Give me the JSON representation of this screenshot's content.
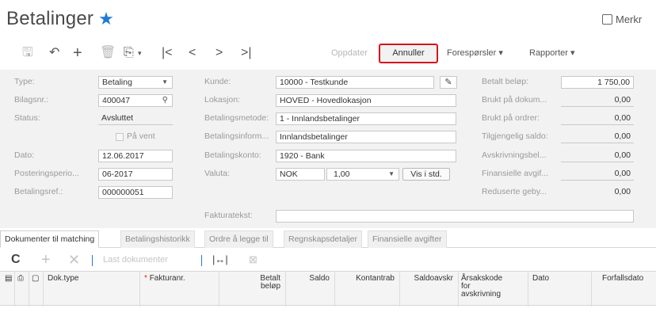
{
  "page": {
    "title": "Betalinger",
    "merk": "Merkr"
  },
  "toolbar": {
    "oppdater": "Oppdater",
    "annuller": "Annuller",
    "foresporsler": "Forespørsler ▾",
    "rapporter": "Rapporter ▾",
    "icons": [
      "save-icon",
      "undo-icon",
      "add-icon",
      "delete-icon",
      "copy-icon",
      "first-icon",
      "prev-icon",
      "next-icon",
      "last-icon"
    ]
  },
  "form": {
    "type_label": "Type:",
    "type_value": "Betaling",
    "bilagsnr_label": "Bilagsnr.:",
    "bilagsnr_value": "400047",
    "status_label": "Status:",
    "status_value": "Avsluttet",
    "pa_vent_label": "På vent",
    "dato_label": "Dato:",
    "dato_value": "12.06.2017",
    "posteringsperiode_label": "Posteringsperio...",
    "posteringsperiode_value": "06-2017",
    "betalingsref_label": "Betalingsref.:",
    "betalingsref_value": "000000051",
    "kunde_label": "Kunde:",
    "kunde_value": "10000 - Testkunde",
    "lokasjon_label": "Lokasjon:",
    "lokasjon_value": "HOVED - Hovedlokasjon",
    "betalingsmetode_label": "Betalingsmetode:",
    "betalingsmetode_value": "1 - Innlandsbetalinger",
    "betalingsinform_label": "Betalingsinform...",
    "betalingsinform_value": "Innlandsbetalinger",
    "betalingskonto_label": "Betalingskonto:",
    "betalingskonto_value": "1920 - Bank",
    "valuta_label": "Valuta:",
    "valuta_value": "NOK",
    "kurs_value": "1,00",
    "vis_i_std": "Vis i std.",
    "fakturatekst_label": "Fakturatekst:",
    "fakturatekst_value": "",
    "betalt_belop_label": "Betalt beløp:",
    "betalt_belop_value": "1 750,00",
    "brukt_dokum_label": "Brukt på dokum...",
    "brukt_dokum_value": "0,00",
    "brukt_ordrer_label": "Brukt på ordrer:",
    "brukt_ordrer_value": "0,00",
    "tilgjengelig_label": "Tilgjengelig saldo:",
    "tilgjengelig_value": "0,00",
    "avskrivning_label": "Avskrivningsbel...",
    "avskrivning_value": "0,00",
    "finansielle_label": "Finansielle avgif...",
    "finansielle_value": "0,00",
    "reduserte_label": "Reduserte geby...",
    "reduserte_value": "0,00"
  },
  "tabs": [
    "Dokumenter til matching",
    "Betalingshistorikk",
    "Ordre å legge til",
    "Regnskapsdetaljer",
    "Finansielle avgifter"
  ],
  "grid": {
    "toolbar": {
      "last_dokumenter": "Last dokumenter"
    },
    "columns": {
      "doktype": "Dok.type",
      "fakturanr": "Fakturanr.",
      "betalt": "Betalt",
      "belop": "beløp",
      "saldo": "Saldo",
      "kontantrab": "Kontantrab",
      "saldoavskr": "Saldoavskr",
      "arsak1": "Årsakskode",
      "arsak2": "for",
      "arsak3": "avskrivning",
      "dato": "Dato",
      "forfallsdato": "Forfallsdato"
    }
  },
  "colors": {
    "accent": "#1e7bd6",
    "highlight": "#d8131a",
    "required": "#e2231a"
  }
}
